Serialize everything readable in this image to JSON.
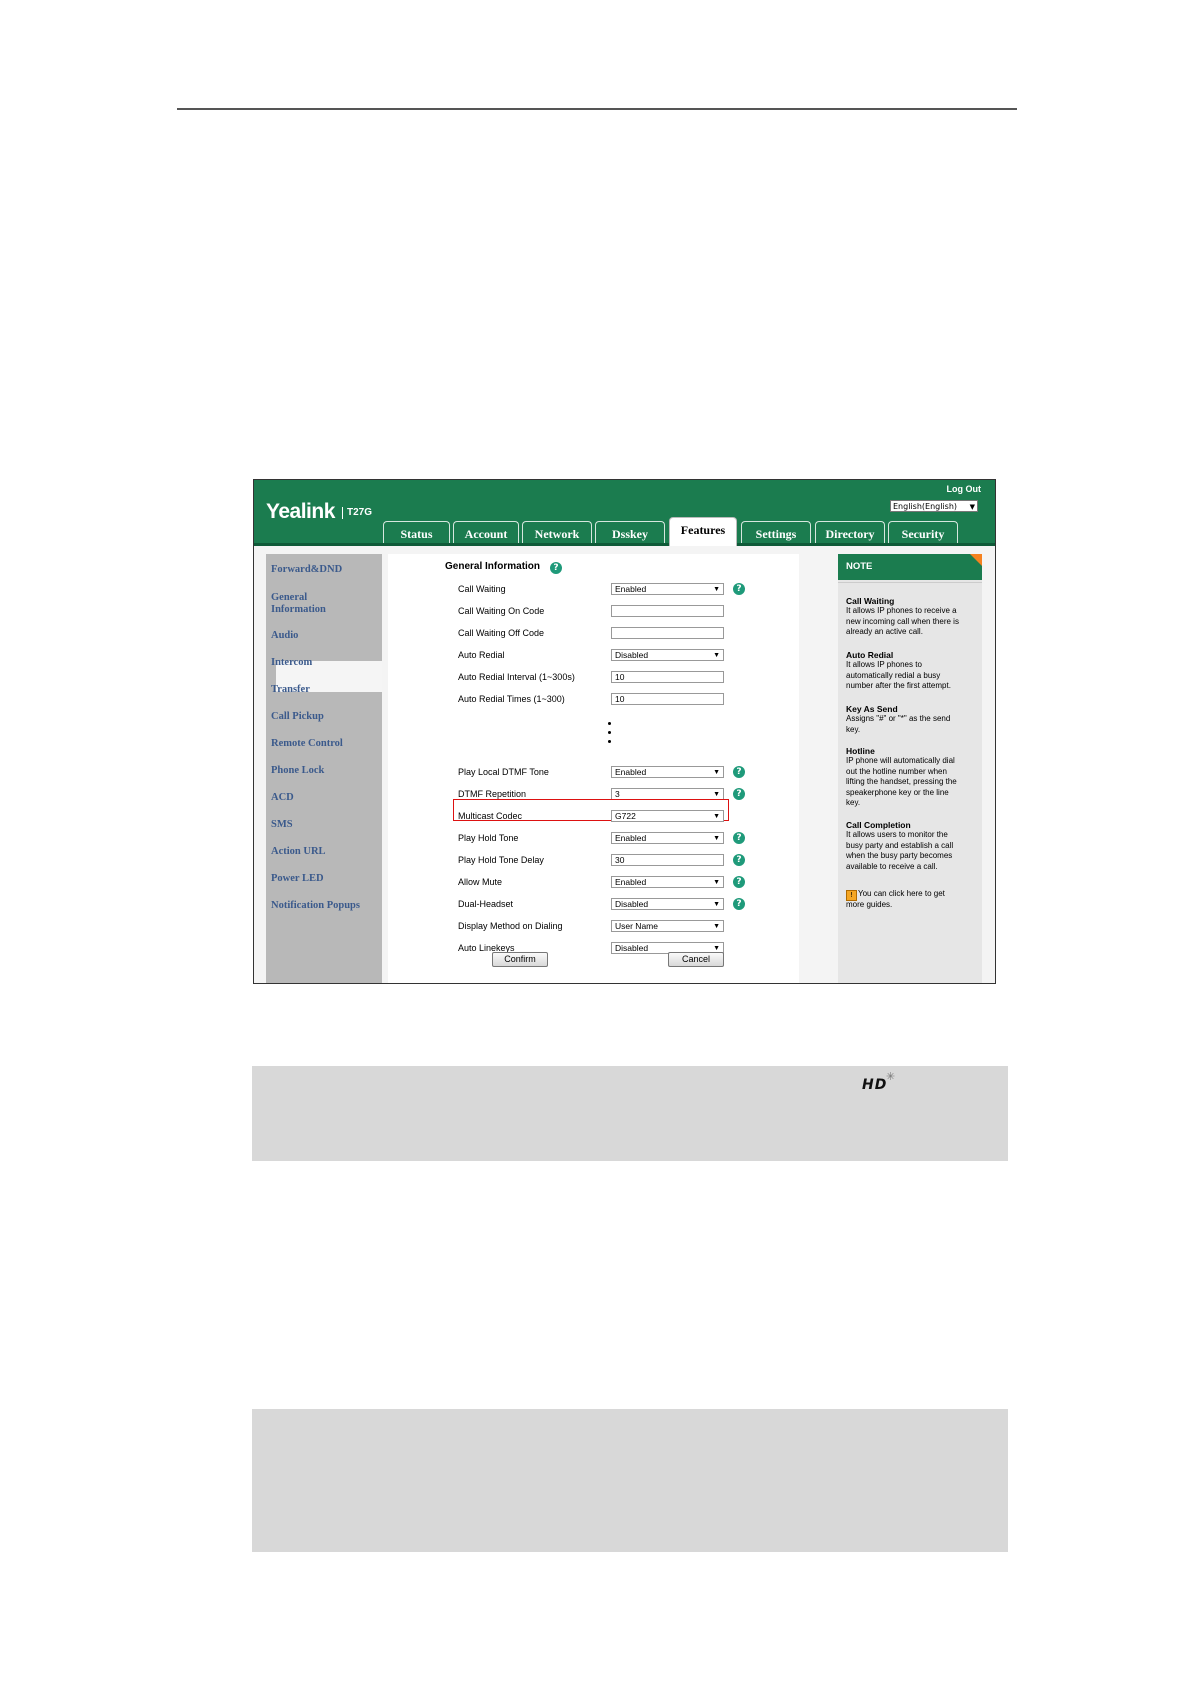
{
  "brand": {
    "logo": "Yealink",
    "model": "T27G"
  },
  "header": {
    "logout": "Log Out",
    "language": "English(English)"
  },
  "tabs": [
    "Status",
    "Account",
    "Network",
    "Dsskey",
    "Features",
    "Settings",
    "Directory",
    "Security"
  ],
  "active_tab": "Features",
  "sidebar": {
    "items": [
      "Forward&DND",
      "General Information",
      "Audio",
      "Intercom",
      "Transfer",
      "Call Pickup",
      "Remote Control",
      "Phone Lock",
      "ACD",
      "SMS",
      "Action URL",
      "Power LED",
      "Notification Popups"
    ],
    "active": "General Information",
    "general_info_line1": "General",
    "general_info_line2": "Information"
  },
  "section": {
    "title": "General Information"
  },
  "rows": [
    {
      "label": "Call Waiting",
      "value": "Enabled",
      "type": "select",
      "help": true
    },
    {
      "label": "Call Waiting On Code",
      "value": "",
      "type": "text",
      "help": false
    },
    {
      "label": "Call Waiting Off Code",
      "value": "",
      "type": "text",
      "help": false
    },
    {
      "label": "Auto Redial",
      "value": "Disabled",
      "type": "select",
      "help": false
    },
    {
      "label": "Auto Redial Interval (1~300s)",
      "value": "10",
      "type": "text",
      "help": false
    },
    {
      "label": "Auto Redial Times (1~300)",
      "value": "10",
      "type": "text",
      "help": false
    },
    {
      "label": "Play Local DTMF Tone",
      "value": "Enabled",
      "type": "select",
      "help": true
    },
    {
      "label": "DTMF Repetition",
      "value": "3",
      "type": "select",
      "help": true
    },
    {
      "label": "Multicast Codec",
      "value": "G722",
      "type": "select",
      "help": false,
      "highlighted": true
    },
    {
      "label": "Play Hold Tone",
      "value": "Enabled",
      "type": "select",
      "help": true
    },
    {
      "label": "Play Hold Tone Delay",
      "value": "30",
      "type": "text",
      "help": true
    },
    {
      "label": "Allow Mute",
      "value": "Enabled",
      "type": "select",
      "help": true
    },
    {
      "label": "Dual-Headset",
      "value": "Disabled",
      "type": "select",
      "help": true
    },
    {
      "label": "Display Method on Dialing",
      "value": "User Name",
      "type": "select",
      "help": false
    },
    {
      "label": "Auto Linekeys",
      "value": "Disabled",
      "type": "select",
      "help": false
    }
  ],
  "buttons": {
    "confirm": "Confirm",
    "cancel": "Cancel"
  },
  "note": {
    "heading": "NOTE",
    "entries": [
      {
        "title": "Call Waiting",
        "lines": [
          "It allows IP phones to receive a",
          "new incoming call when there is",
          "already an active call."
        ]
      },
      {
        "title": "Auto Redial",
        "lines": [
          "It allows IP phones to",
          "automatically redial a busy",
          "number after the first attempt."
        ]
      },
      {
        "title": "Key As Send",
        "lines": [
          "Assigns \"#\" or \"*\" as the send",
          "key."
        ]
      },
      {
        "title": "Hotline",
        "lines": [
          "IP phone will automatically dial",
          "out the hotline number when",
          "lifting the handset, pressing the",
          "speakerphone key or the line",
          "key."
        ]
      },
      {
        "title": "Call Completion",
        "lines": [
          "It allows users to monitor the",
          "busy party and establish a call",
          "when the busy party becomes",
          "available to receive a call."
        ]
      }
    ],
    "guide_line1": "You can click here to get",
    "guide_line2": "more guides."
  },
  "page": {
    "hd_logo": "HD"
  },
  "colors": {
    "brand_green": "#1b7c4f",
    "link_blue": "#3b5a8c",
    "highlight_red": "#dd1111",
    "note_orange": "#f58220"
  }
}
